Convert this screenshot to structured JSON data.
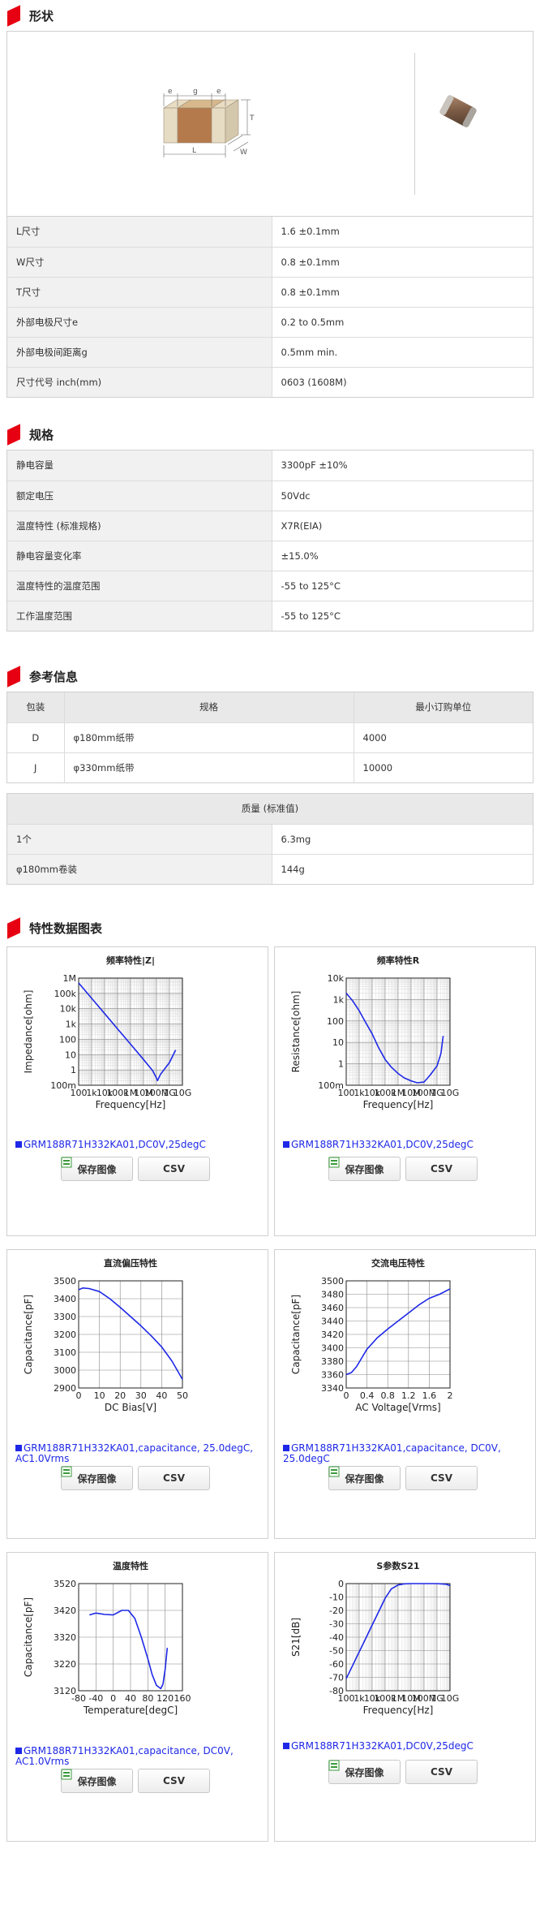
{
  "sections": {
    "shape": "形状",
    "spec": "规格",
    "reference": "参考信息",
    "charts": "特性数据图表"
  },
  "diagram_labels": {
    "e1": "e",
    "g": "g",
    "e2": "e",
    "T": "T",
    "L": "L",
    "W": "W"
  },
  "shape_rows": [
    {
      "k": "L尺寸",
      "v": "1.6 ±0.1mm"
    },
    {
      "k": "W尺寸",
      "v": "0.8 ±0.1mm"
    },
    {
      "k": "T尺寸",
      "v": "0.8 ±0.1mm"
    },
    {
      "k": "外部电极尺寸e",
      "v": "0.2 to 0.5mm"
    },
    {
      "k": "外部电极间距离g",
      "v": "0.5mm min."
    },
    {
      "k": "尺寸代号 inch(mm)",
      "v": "0603 (1608M)"
    }
  ],
  "spec_rows": [
    {
      "k": "静电容量",
      "v": "3300pF ±10%"
    },
    {
      "k": "额定电压",
      "v": "50Vdc"
    },
    {
      "k": "温度特性 (标准规格)",
      "v": "X7R(EIA)"
    },
    {
      "k": "静电容量变化率",
      "v": "±15.0%"
    },
    {
      "k": "温度特性的温度范围",
      "v": "-55 to 125°C"
    },
    {
      "k": "工作温度范围",
      "v": "-55 to 125°C"
    }
  ],
  "packaging": {
    "headers": [
      "包装",
      "规格",
      "最小订购单位"
    ],
    "rows": [
      [
        "D",
        "φ180mm纸带",
        "4000"
      ],
      [
        "J",
        "φ330mm纸带",
        "10000"
      ]
    ]
  },
  "mass": {
    "header": "质量 (标准值)",
    "rows": [
      {
        "k": "1个",
        "v": "6.3mg"
      },
      {
        "k": "φ180mm卷装",
        "v": "144g"
      }
    ]
  },
  "buttons": {
    "save": "保存图像",
    "csv": "CSV"
  },
  "colors": {
    "accent": "#e60012",
    "series": "#1e28e6"
  },
  "chart_data": [
    {
      "type": "line",
      "title": "频率特性|Z|",
      "xlabel": "Frequency[Hz]",
      "ylabel": "Impedance[ohm]",
      "x_scale": "log",
      "y_scale": "log",
      "xlim": [
        100,
        10000000000
      ],
      "ylim": [
        0.1,
        1000000
      ],
      "x_ticks": [
        "100",
        "1k",
        "10k",
        "100k",
        "1M",
        "10M",
        "100M",
        "1G",
        "10G"
      ],
      "y_ticks": [
        "1M",
        "100k",
        "10k",
        "1k",
        "100",
        "10",
        "1",
        "100m"
      ],
      "series": [
        {
          "name": "GRM188R71H332KA01,DC0V,25degC",
          "x": [
            100,
            1000,
            10000,
            100000,
            1000000,
            10000000,
            50000000,
            90000000,
            120000000,
            200000000,
            500000000,
            1000000000,
            3000000000
          ],
          "y": [
            480000,
            48000,
            4800,
            480,
            48,
            4.8,
            0.9,
            0.35,
            0.2,
            0.5,
            1.4,
            3.0,
            20
          ]
        }
      ]
    },
    {
      "type": "line",
      "title": "频率特性R",
      "xlabel": "Frequency[Hz]",
      "ylabel": "Resistance[ohm]",
      "x_scale": "log",
      "y_scale": "log",
      "xlim": [
        100,
        10000000000
      ],
      "ylim": [
        0.1,
        10000
      ],
      "x_ticks": [
        "100",
        "1k",
        "10k",
        "100k",
        "1M",
        "10M",
        "100M",
        "1G",
        "10G"
      ],
      "y_ticks": [
        "10k",
        "1k",
        "100",
        "10",
        "1",
        "100m"
      ],
      "series": [
        {
          "name": "GRM188R71H332KA01,DC0V,25degC",
          "x": [
            100,
            300,
            1000,
            3000,
            10000,
            30000,
            100000,
            300000,
            1000000,
            3000000,
            10000000,
            30000000,
            100000000,
            300000000,
            1000000000,
            2000000000,
            3000000000
          ],
          "y": [
            2000,
            900,
            300,
            90,
            25,
            6,
            1.6,
            0.7,
            0.35,
            0.22,
            0.16,
            0.13,
            0.14,
            0.3,
            0.8,
            3,
            20
          ]
        }
      ]
    },
    {
      "type": "line",
      "title": "直流偏压特性",
      "xlabel": "DC Bias[V]",
      "ylabel": "Capacitance[pF]",
      "xlim": [
        0,
        50
      ],
      "ylim": [
        2900,
        3500
      ],
      "x_ticks": [
        "0",
        "10",
        "20",
        "30",
        "40",
        "50"
      ],
      "y_ticks": [
        "3500",
        "3400",
        "3300",
        "3200",
        "3100",
        "3000",
        "2900"
      ],
      "series": [
        {
          "name": "GRM188R71H332KA01,capacitance, 25.0degC, AC1.0Vrms",
          "x": [
            0,
            2,
            5,
            10,
            15,
            20,
            25,
            30,
            35,
            40,
            45,
            50
          ],
          "y": [
            3450,
            3460,
            3457,
            3440,
            3400,
            3352,
            3300,
            3248,
            3192,
            3130,
            3050,
            2948
          ]
        }
      ]
    },
    {
      "type": "line",
      "title": "交流电压特性",
      "xlabel": "AC Voltage[Vrms]",
      "ylabel": "Capacitance[pF]",
      "xlim": [
        0,
        2
      ],
      "ylim": [
        3340,
        3500
      ],
      "x_ticks": [
        "0",
        "0.4",
        "0.8",
        "1.2",
        "1.6",
        "2"
      ],
      "y_ticks": [
        "3500",
        "3480",
        "3460",
        "3440",
        "3420",
        "3400",
        "3380",
        "3360",
        "3340"
      ],
      "series": [
        {
          "name": "GRM188R71H332KA01,capacitance, DC0V, 25.0degC",
          "x": [
            0,
            0.1,
            0.2,
            0.3,
            0.4,
            0.6,
            0.8,
            1.0,
            1.2,
            1.4,
            1.6,
            1.8,
            2.0
          ],
          "y": [
            3360,
            3363,
            3372,
            3385,
            3398,
            3415,
            3428,
            3440,
            3452,
            3464,
            3474,
            3480,
            3488
          ]
        }
      ]
    },
    {
      "type": "line",
      "title": "温度特性",
      "xlabel": "Temperature[degC]",
      "ylabel": "Capacitance[pF]",
      "xlim": [
        -80,
        160
      ],
      "ylim": [
        3120,
        3520
      ],
      "x_ticks": [
        "-80",
        "-40",
        "0",
        "40",
        "80",
        "120",
        "160"
      ],
      "y_ticks": [
        "3520",
        "3420",
        "3320",
        "3220",
        "3120"
      ],
      "series": [
        {
          "name": "GRM188R71H332KA01,capacitance, DC0V, AC1.0Vrms",
          "x": [
            -55,
            -40,
            -20,
            0,
            20,
            35,
            50,
            65,
            80,
            90,
            100,
            110,
            115,
            120,
            125
          ],
          "y": [
            3403,
            3410,
            3405,
            3403,
            3420,
            3420,
            3390,
            3320,
            3240,
            3180,
            3140,
            3128,
            3145,
            3200,
            3280
          ]
        }
      ]
    },
    {
      "type": "line",
      "title": "S参数S21",
      "xlabel": "Frequency[Hz]",
      "ylabel": "S21[dB]",
      "x_scale": "log",
      "xlim": [
        100,
        10000000000
      ],
      "ylim": [
        -80,
        0
      ],
      "x_ticks": [
        "100",
        "1k",
        "10k",
        "100k",
        "1M",
        "10M",
        "100M",
        "1G",
        "10G"
      ],
      "y_ticks": [
        "0",
        "-10",
        "-20",
        "-30",
        "-40",
        "-50",
        "-60",
        "-70",
        "-80"
      ],
      "series": [
        {
          "name": "GRM188R71H332KA01,DC0V,25degC",
          "x": [
            100,
            1000,
            10000,
            100000,
            300000,
            1000000,
            3000000,
            10000000,
            100000000,
            1000000000,
            5000000000,
            10000000000
          ],
          "y": [
            -71,
            -51,
            -31,
            -11,
            -4,
            -1,
            -0.2,
            0,
            0,
            0,
            -0.5,
            -1.5
          ]
        }
      ]
    }
  ]
}
